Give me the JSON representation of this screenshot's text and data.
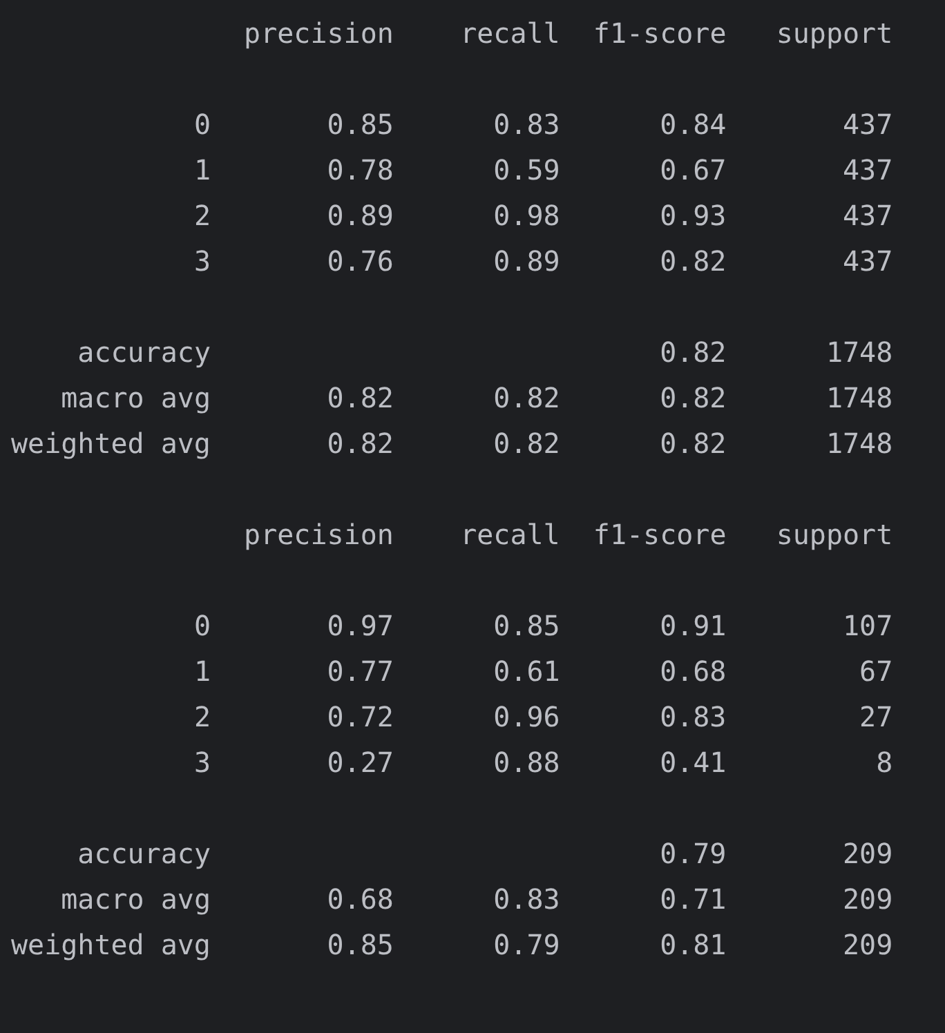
{
  "reports": [
    {
      "columns": [
        "precision",
        "recall",
        "f1-score",
        "support"
      ],
      "class_rows": [
        {
          "label": "0",
          "precision": "0.85",
          "recall": "0.83",
          "f1_score": "0.84",
          "support": "437"
        },
        {
          "label": "1",
          "precision": "0.78",
          "recall": "0.59",
          "f1_score": "0.67",
          "support": "437"
        },
        {
          "label": "2",
          "precision": "0.89",
          "recall": "0.98",
          "f1_score": "0.93",
          "support": "437"
        },
        {
          "label": "3",
          "precision": "0.76",
          "recall": "0.89",
          "f1_score": "0.82",
          "support": "437"
        }
      ],
      "summary_rows": [
        {
          "label": "accuracy",
          "f1_score": "0.82",
          "support": "1748"
        },
        {
          "label": "macro avg",
          "precision": "0.82",
          "recall": "0.82",
          "f1_score": "0.82",
          "support": "1748"
        },
        {
          "label": "weighted avg",
          "precision": "0.82",
          "recall": "0.82",
          "f1_score": "0.82",
          "support": "1748"
        }
      ]
    },
    {
      "columns": [
        "precision",
        "recall",
        "f1-score",
        "support"
      ],
      "class_rows": [
        {
          "label": "0",
          "precision": "0.97",
          "recall": "0.85",
          "f1_score": "0.91",
          "support": "107"
        },
        {
          "label": "1",
          "precision": "0.77",
          "recall": "0.61",
          "f1_score": "0.68",
          "support": "67"
        },
        {
          "label": "2",
          "precision": "0.72",
          "recall": "0.96",
          "f1_score": "0.83",
          "support": "27"
        },
        {
          "label": "3",
          "precision": "0.27",
          "recall": "0.88",
          "f1_score": "0.41",
          "support": "8"
        }
      ],
      "summary_rows": [
        {
          "label": "accuracy",
          "f1_score": "0.79",
          "support": "209"
        },
        {
          "label": "macro avg",
          "precision": "0.68",
          "recall": "0.83",
          "f1_score": "0.71",
          "support": "209"
        },
        {
          "label": "weighted avg",
          "precision": "0.85",
          "recall": "0.79",
          "f1_score": "0.81",
          "support": "209"
        }
      ]
    }
  ]
}
